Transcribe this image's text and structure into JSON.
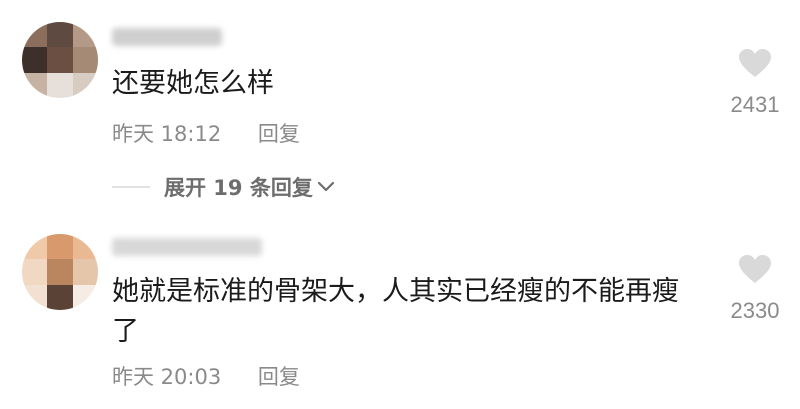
{
  "comments": [
    {
      "text": "还要她怎么样",
      "time": "昨天 18:12",
      "reply_label": "回复",
      "likes": "2431",
      "avatar_icon": "user-avatar-icon",
      "like_icon": "heart-icon"
    },
    {
      "text": "她就是标准的骨架大，人其实已经瘦的不能再瘦了",
      "time": "昨天 20:03",
      "reply_label": "回复",
      "likes": "2330",
      "avatar_icon": "user-avatar-icon",
      "like_icon": "heart-icon"
    }
  ],
  "expand_replies": {
    "label": "展开 19 条回复",
    "icon": "chevron-down-icon"
  },
  "colors": {
    "primary_text": "#1b1b1b",
    "secondary_text": "#8a8a8a",
    "heart": "#d9d9d9",
    "divider": "#e2e2e2"
  }
}
